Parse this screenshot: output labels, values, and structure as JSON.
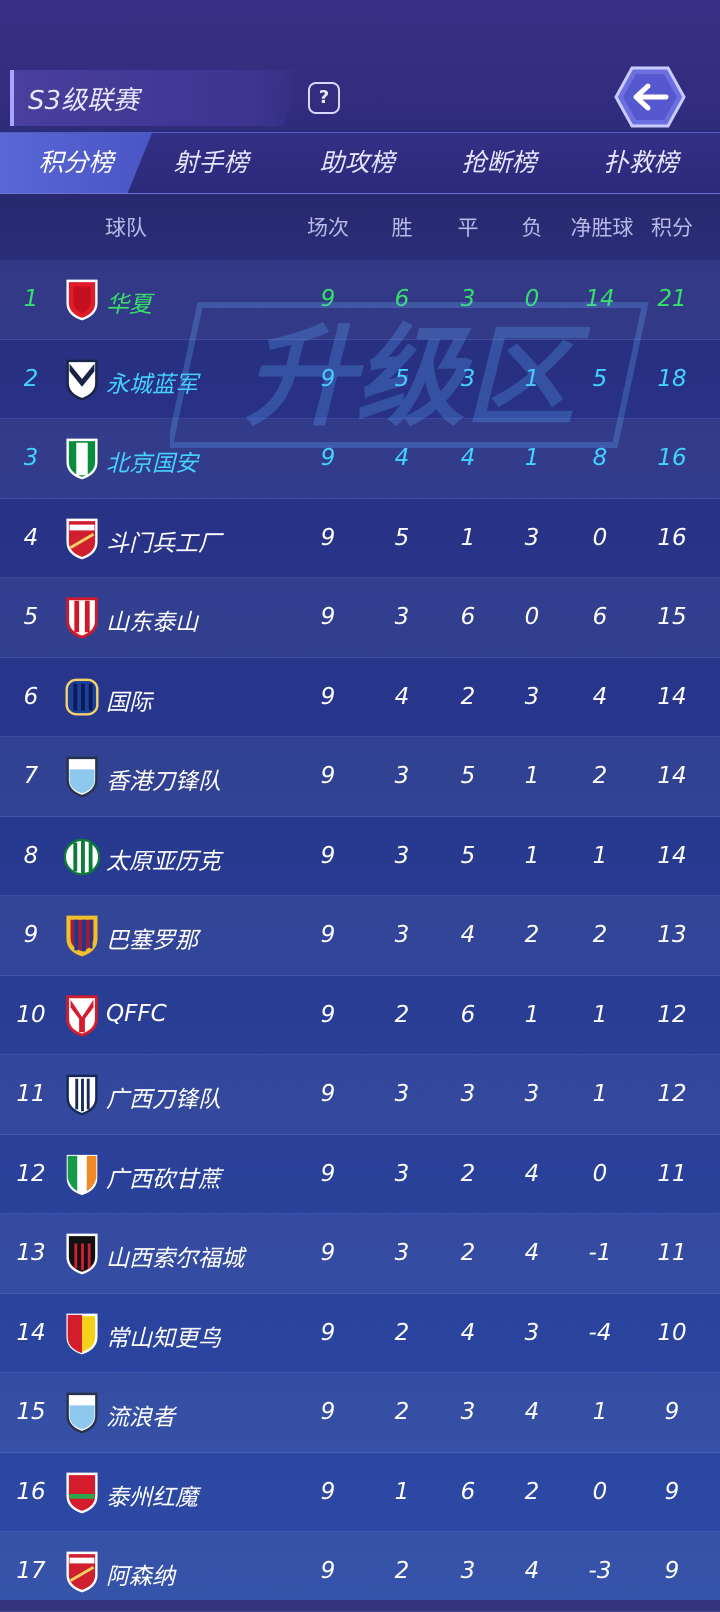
{
  "header": {
    "league_title": "S3级联赛",
    "help_label": "?"
  },
  "tabs": [
    {
      "label": "积分榜",
      "active": true
    },
    {
      "label": "射手榜",
      "active": false
    },
    {
      "label": "助攻榜",
      "active": false
    },
    {
      "label": "抢断榜",
      "active": false
    },
    {
      "label": "扑救榜",
      "active": false
    }
  ],
  "columns": {
    "team": "球队",
    "played": "场次",
    "win": "胜",
    "draw": "平",
    "loss": "负",
    "gd": "净胜球",
    "points": "积分"
  },
  "watermark": "升级区",
  "colors": {
    "champion": "#35e06a",
    "promotion": "#44d2ff",
    "normal": "#ffffff"
  },
  "rows": [
    {
      "rank": "1",
      "team": "华夏",
      "played": "9",
      "win": "6",
      "draw": "3",
      "loss": "0",
      "gd": "14",
      "points": "21",
      "zone": "champion",
      "crest": "red-shield"
    },
    {
      "rank": "2",
      "team": "永城蓝军",
      "played": "9",
      "win": "5",
      "draw": "3",
      "loss": "1",
      "gd": "5",
      "points": "18",
      "zone": "promotion",
      "crest": "navy-chevron"
    },
    {
      "rank": "3",
      "team": "北京国安",
      "played": "9",
      "win": "4",
      "draw": "4",
      "loss": "1",
      "gd": "8",
      "points": "16",
      "zone": "promotion",
      "crest": "green-white"
    },
    {
      "rank": "4",
      "team": "斗门兵工厂",
      "played": "9",
      "win": "5",
      "draw": "1",
      "loss": "3",
      "gd": "0",
      "points": "16",
      "zone": "normal",
      "crest": "red-stripe"
    },
    {
      "rank": "5",
      "team": "山东泰山",
      "played": "9",
      "win": "3",
      "draw": "6",
      "loss": "0",
      "gd": "6",
      "points": "15",
      "zone": "normal",
      "crest": "red-white-chevron"
    },
    {
      "rank": "6",
      "team": "国际",
      "played": "9",
      "win": "4",
      "draw": "2",
      "loss": "3",
      "gd": "4",
      "points": "14",
      "zone": "normal",
      "crest": "blue-stripes"
    },
    {
      "rank": "7",
      "team": "香港刀锋队",
      "played": "9",
      "win": "3",
      "draw": "5",
      "loss": "1",
      "gd": "2",
      "points": "14",
      "zone": "normal",
      "crest": "light-blue"
    },
    {
      "rank": "8",
      "team": "太原亚历克",
      "played": "9",
      "win": "3",
      "draw": "5",
      "loss": "1",
      "gd": "1",
      "points": "14",
      "zone": "normal",
      "crest": "green-round"
    },
    {
      "rank": "9",
      "team": "巴塞罗那",
      "played": "9",
      "win": "3",
      "draw": "4",
      "loss": "2",
      "gd": "2",
      "points": "13",
      "zone": "normal",
      "crest": "blaugrana"
    },
    {
      "rank": "10",
      "team": "QFFC",
      "played": "9",
      "win": "2",
      "draw": "6",
      "loss": "1",
      "gd": "1",
      "points": "12",
      "zone": "normal",
      "crest": "red-y"
    },
    {
      "rank": "11",
      "team": "广西刀锋队",
      "played": "9",
      "win": "3",
      "draw": "3",
      "loss": "3",
      "gd": "1",
      "points": "12",
      "zone": "normal",
      "crest": "navy-lines"
    },
    {
      "rank": "12",
      "team": "广西砍甘蔗",
      "played": "9",
      "win": "3",
      "draw": "2",
      "loss": "4",
      "gd": "0",
      "points": "11",
      "zone": "normal",
      "crest": "tricolor"
    },
    {
      "rank": "13",
      "team": "山西索尔福城",
      "played": "9",
      "win": "3",
      "draw": "2",
      "loss": "4",
      "gd": "-1",
      "points": "11",
      "zone": "normal",
      "crest": "black-red"
    },
    {
      "rank": "14",
      "team": "常山知更鸟",
      "played": "9",
      "win": "2",
      "draw": "4",
      "loss": "3",
      "gd": "-4",
      "points": "10",
      "zone": "normal",
      "crest": "red-yellow"
    },
    {
      "rank": "15",
      "team": "流浪者",
      "played": "9",
      "win": "2",
      "draw": "3",
      "loss": "4",
      "gd": "1",
      "points": "9",
      "zone": "normal",
      "crest": "light-blue"
    },
    {
      "rank": "16",
      "team": "泰州红魔",
      "played": "9",
      "win": "1",
      "draw": "6",
      "loss": "2",
      "gd": "0",
      "points": "9",
      "zone": "normal",
      "crest": "red-green"
    },
    {
      "rank": "17",
      "team": "阿森纳",
      "played": "9",
      "win": "2",
      "draw": "3",
      "loss": "4",
      "gd": "-3",
      "points": "9",
      "zone": "normal",
      "crest": "red-stripe"
    }
  ]
}
